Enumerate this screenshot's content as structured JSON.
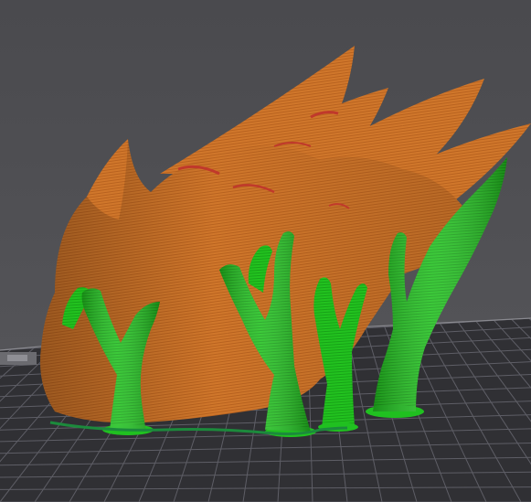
{
  "viewport": {
    "background_top": "#4a4a4e",
    "background_bottom": "#58585c",
    "bed_color": "#303034",
    "grid_line_color": "#5e5e66",
    "bed_edge_color": "#8a8a90"
  },
  "model": {
    "name": "",
    "shell_color": "#d0772b",
    "shell_shadow": "#9a4f1c",
    "shell_highlight": "#e7954a",
    "overhang_color": "#c0392b",
    "support_color": "#20c020",
    "support_shadow": "#0f8a12",
    "support_highlight": "#5de05a",
    "brim_color": "#1c8a3c"
  }
}
